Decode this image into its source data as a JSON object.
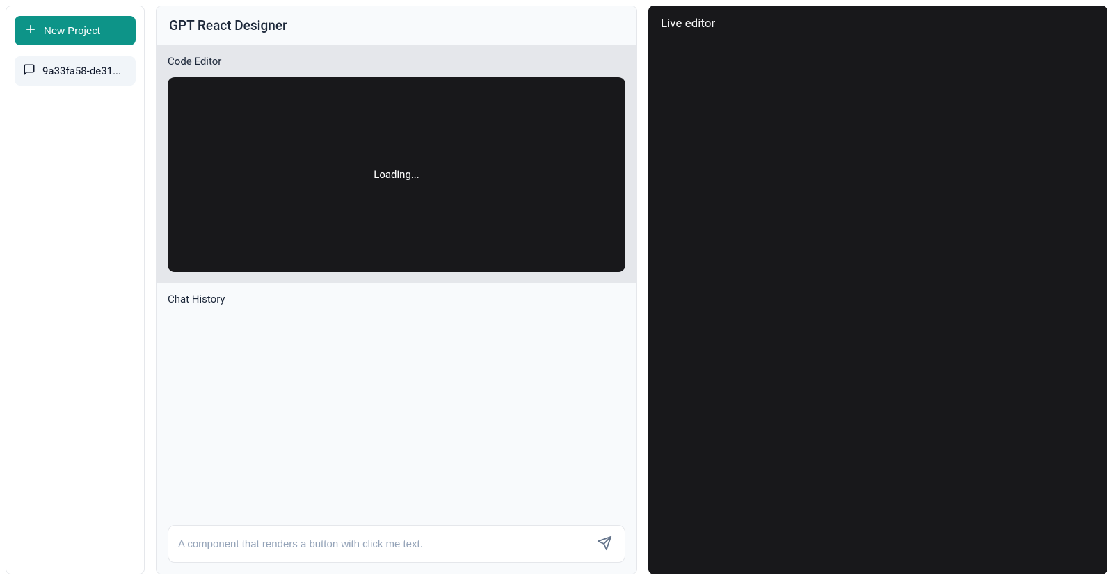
{
  "sidebar": {
    "new_project_label": "New Project",
    "projects": [
      {
        "label": "9a33fa58-de31..."
      }
    ]
  },
  "main": {
    "title": "GPT React Designer",
    "code_editor_label": "Code Editor",
    "code_editor_status": "Loading...",
    "chat_history_label": "Chat History",
    "chat_input_placeholder": "A component that renders a button with click me text."
  },
  "live": {
    "title": "Live editor"
  }
}
